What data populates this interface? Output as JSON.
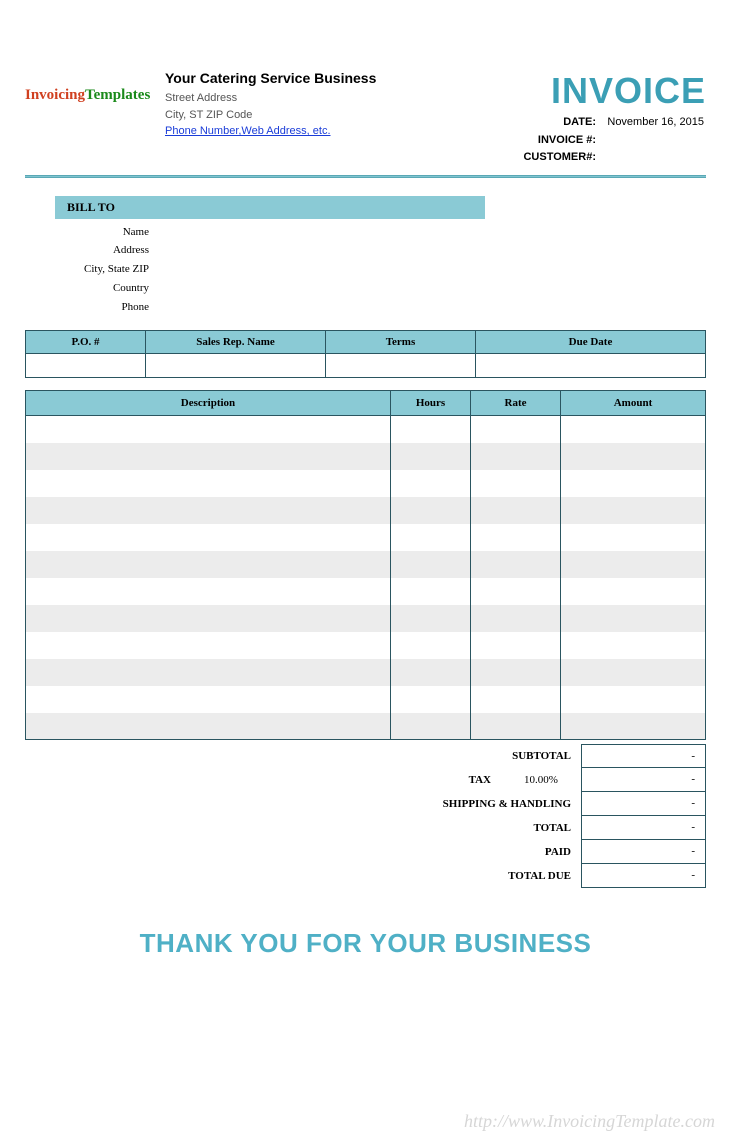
{
  "logo": {
    "part1": "Invoicing",
    "part2": "Templates"
  },
  "company": {
    "name": "Your Catering  Service Business",
    "street": "Street Address",
    "city": "City, ST  ZIP Code",
    "link": "Phone Number,Web Address, etc."
  },
  "title": "INVOICE",
  "meta": {
    "date_label": "DATE:",
    "date_value": "November 16, 2015",
    "invoice_label": "INVOICE #:",
    "invoice_value": "",
    "customer_label": "CUSTOMER#:",
    "customer_value": ""
  },
  "billto": {
    "heading": "BILL TO",
    "labels": {
      "name": "Name",
      "address": "Address",
      "citystate": "City, State ZIP",
      "country": "Country",
      "phone": "Phone"
    },
    "values": {
      "name": "",
      "address": "",
      "citystate": "",
      "country": "",
      "phone": ""
    }
  },
  "po": {
    "headers": {
      "po": "P.O. #",
      "rep": "Sales Rep. Name",
      "terms": "Terms",
      "due": "Due Date"
    },
    "values": {
      "po": "",
      "rep": "",
      "terms": "",
      "due": ""
    }
  },
  "items": {
    "headers": {
      "desc": "Description",
      "hours": "Hours",
      "rate": "Rate",
      "amount": "Amount"
    },
    "rows": [
      {
        "desc": "",
        "hours": "",
        "rate": "",
        "amount": ""
      },
      {
        "desc": "",
        "hours": "",
        "rate": "",
        "amount": ""
      },
      {
        "desc": "",
        "hours": "",
        "rate": "",
        "amount": ""
      },
      {
        "desc": "",
        "hours": "",
        "rate": "",
        "amount": ""
      },
      {
        "desc": "",
        "hours": "",
        "rate": "",
        "amount": ""
      },
      {
        "desc": "",
        "hours": "",
        "rate": "",
        "amount": ""
      },
      {
        "desc": "",
        "hours": "",
        "rate": "",
        "amount": ""
      },
      {
        "desc": "",
        "hours": "",
        "rate": "",
        "amount": ""
      },
      {
        "desc": "",
        "hours": "",
        "rate": "",
        "amount": ""
      },
      {
        "desc": "",
        "hours": "",
        "rate": "",
        "amount": ""
      },
      {
        "desc": "",
        "hours": "",
        "rate": "",
        "amount": ""
      },
      {
        "desc": "",
        "hours": "",
        "rate": "",
        "amount": ""
      }
    ]
  },
  "totals": {
    "subtotal_label": "SUBTOTAL",
    "subtotal_value": "-",
    "tax_label": "TAX",
    "tax_rate": "10.00%",
    "tax_value": "-",
    "shipping_label": "SHIPPING & HANDLING",
    "shipping_value": "-",
    "total_label": "TOTAL",
    "total_value": "-",
    "paid_label": "PAID",
    "paid_value": "-",
    "due_label": "TOTAL DUE",
    "due_value": "-"
  },
  "thanks": "THANK YOU FOR YOUR BUSINESS",
  "watermark": "http://www.InvoicingTemplate.com"
}
